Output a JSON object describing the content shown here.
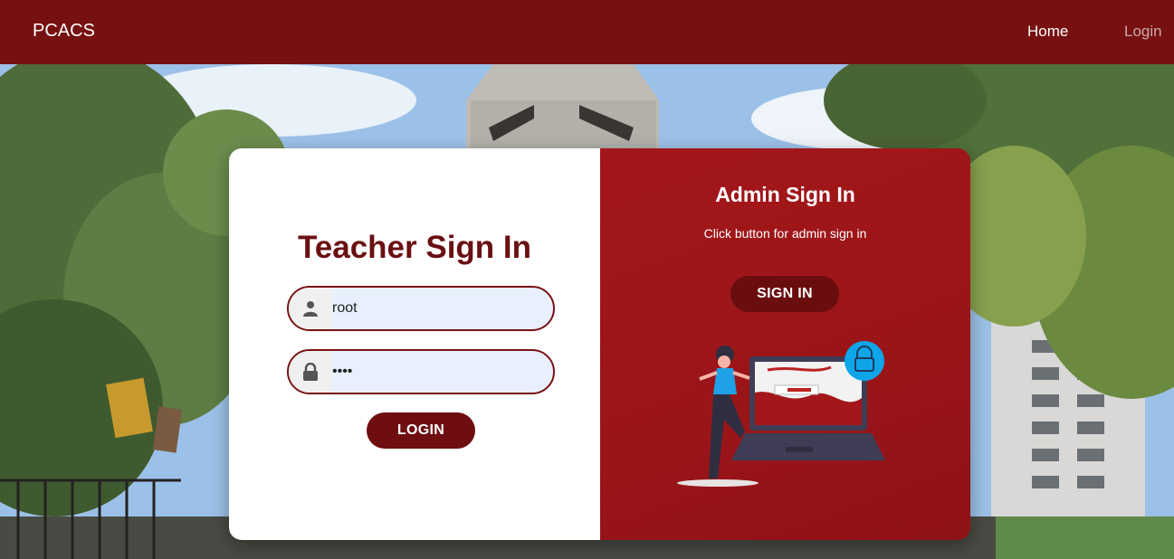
{
  "nav": {
    "brand": "PCACS",
    "home": "Home",
    "login": "Login"
  },
  "teacher": {
    "title": "Teacher Sign In",
    "username_value": "root",
    "password_value": "root",
    "login_button": "LOGIN"
  },
  "admin": {
    "title": "Admin Sign In",
    "subtitle": "Click button for admin sign in",
    "sign_in_button": "SIGN IN"
  },
  "icons": {
    "username": "user-icon",
    "password": "lock-icon"
  },
  "colors": {
    "navbar": "#761011",
    "accent": "#a3161a",
    "button": "#6f0e10",
    "title": "#6a0f12"
  }
}
